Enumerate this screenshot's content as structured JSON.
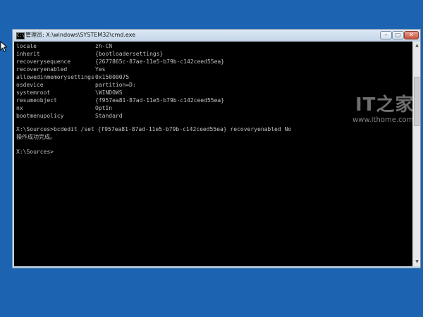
{
  "window": {
    "title": "管理员: X:\\windows\\SYSTEM32\\cmd.exe",
    "icon_label": "C:\\",
    "buttons": {
      "minimize": "–",
      "maximize": "□",
      "close": "✕"
    }
  },
  "console": {
    "entries": [
      {
        "key": "locale",
        "value": "zh-CN"
      },
      {
        "key": "inherit",
        "value": "{bootloadersettings}"
      },
      {
        "key": "recoverysequence",
        "value": "{2677865c-87ae-11e5-b79b-c142ceed55ea}"
      },
      {
        "key": "recoveryenabled",
        "value": "Yes"
      },
      {
        "key": "allowedinmemorysettings",
        "value": "0x15000075"
      },
      {
        "key": "osdevice",
        "value": "partition=D:"
      },
      {
        "key": "systemroot",
        "value": "\\WINDOWS"
      },
      {
        "key": "resumeobject",
        "value": "{f957ea81-87ad-11e5-b79b-c142ceed55ea}"
      },
      {
        "key": "nx",
        "value": "OptIn"
      },
      {
        "key": "bootmenupolicy",
        "value": "Standard"
      }
    ],
    "command": "X:\\Sources>bcdedit /set {f957ea81-87ad-11e5-b79b-c142ceed55ea} recoveryenabled No",
    "result": "操作成功完成。",
    "prompt": "X:\\Sources>"
  },
  "scrollbar": {
    "up": "▲",
    "down": "▼"
  },
  "watermark": {
    "logo": "IT之家",
    "url": "www.ithome.com"
  }
}
